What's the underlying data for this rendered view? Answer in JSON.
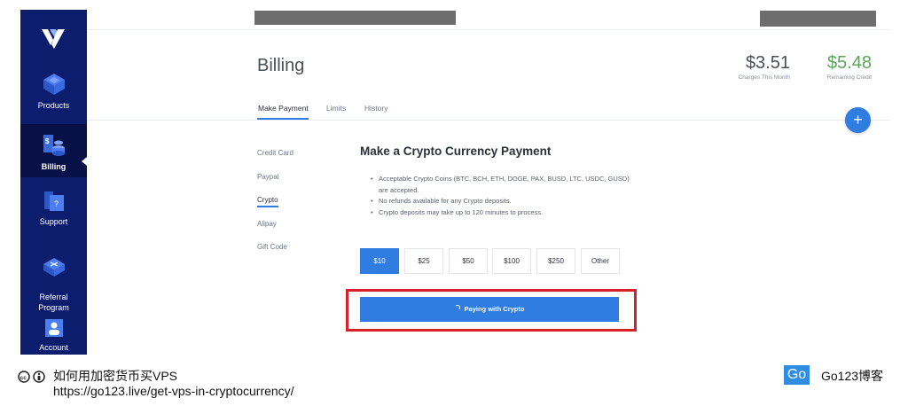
{
  "sidebar": {
    "items": [
      {
        "label": "Products",
        "icon": "products-icon"
      },
      {
        "label": "Billing",
        "icon": "billing-icon",
        "active": true
      },
      {
        "label": "Support",
        "icon": "support-icon"
      },
      {
        "label": "Referral\nProgram",
        "icon": "referral-icon"
      },
      {
        "label": "Account",
        "icon": "account-icon"
      }
    ]
  },
  "header": {
    "title": "Billing",
    "charges": {
      "amount": "$3.51",
      "caption": "Charges This Month"
    },
    "remaining": {
      "amount": "$5.48",
      "caption": "Remaining Credit"
    }
  },
  "tabs": [
    "Make Payment",
    "Limits",
    "History"
  ],
  "payment_methods": [
    "Credit Card",
    "Paypal",
    "Crypto",
    "Alipay",
    "Gift Code"
  ],
  "crypto": {
    "title": "Make a Crypto Currency Payment",
    "bullets": [
      "Acceptable Crypto Coins (BTC, BCH, ETH, DOGE, PAX, BUSD, LTC, USDC, GUSD) are accepted.",
      "No refunds available for any Crypto deposits.",
      "Crypto deposits may take up to 120 minutes to process."
    ],
    "amounts": [
      "$10",
      "$25",
      "$50",
      "$100",
      "$250",
      "Other"
    ],
    "pay_button": "Paying with Crypto"
  },
  "footer": {
    "title": "如何用加密货币买VPS",
    "url": "https://go123.live/get-vps-in-cryptocurrency/",
    "badge": "Go",
    "brand": "Go123博客"
  },
  "colors": {
    "sidebar": "#0d1d6e",
    "accent": "#2f7de1",
    "green": "#5aa55a",
    "highlight": "#d8202a"
  }
}
